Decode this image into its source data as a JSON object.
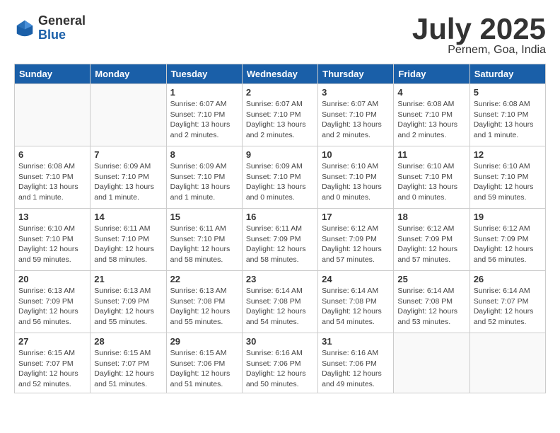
{
  "header": {
    "logo_general": "General",
    "logo_blue": "Blue",
    "month_title": "July 2025",
    "subtitle": "Pernem, Goa, India"
  },
  "days_of_week": [
    "Sunday",
    "Monday",
    "Tuesday",
    "Wednesday",
    "Thursday",
    "Friday",
    "Saturday"
  ],
  "weeks": [
    [
      {
        "day": "",
        "info": ""
      },
      {
        "day": "",
        "info": ""
      },
      {
        "day": "1",
        "info": "Sunrise: 6:07 AM\nSunset: 7:10 PM\nDaylight: 13 hours\nand 2 minutes."
      },
      {
        "day": "2",
        "info": "Sunrise: 6:07 AM\nSunset: 7:10 PM\nDaylight: 13 hours\nand 2 minutes."
      },
      {
        "day": "3",
        "info": "Sunrise: 6:07 AM\nSunset: 7:10 PM\nDaylight: 13 hours\nand 2 minutes."
      },
      {
        "day": "4",
        "info": "Sunrise: 6:08 AM\nSunset: 7:10 PM\nDaylight: 13 hours\nand 2 minutes."
      },
      {
        "day": "5",
        "info": "Sunrise: 6:08 AM\nSunset: 7:10 PM\nDaylight: 13 hours\nand 1 minute."
      }
    ],
    [
      {
        "day": "6",
        "info": "Sunrise: 6:08 AM\nSunset: 7:10 PM\nDaylight: 13 hours\nand 1 minute."
      },
      {
        "day": "7",
        "info": "Sunrise: 6:09 AM\nSunset: 7:10 PM\nDaylight: 13 hours\nand 1 minute."
      },
      {
        "day": "8",
        "info": "Sunrise: 6:09 AM\nSunset: 7:10 PM\nDaylight: 13 hours\nand 1 minute."
      },
      {
        "day": "9",
        "info": "Sunrise: 6:09 AM\nSunset: 7:10 PM\nDaylight: 13 hours\nand 0 minutes."
      },
      {
        "day": "10",
        "info": "Sunrise: 6:10 AM\nSunset: 7:10 PM\nDaylight: 13 hours\nand 0 minutes."
      },
      {
        "day": "11",
        "info": "Sunrise: 6:10 AM\nSunset: 7:10 PM\nDaylight: 13 hours\nand 0 minutes."
      },
      {
        "day": "12",
        "info": "Sunrise: 6:10 AM\nSunset: 7:10 PM\nDaylight: 12 hours\nand 59 minutes."
      }
    ],
    [
      {
        "day": "13",
        "info": "Sunrise: 6:10 AM\nSunset: 7:10 PM\nDaylight: 12 hours\nand 59 minutes."
      },
      {
        "day": "14",
        "info": "Sunrise: 6:11 AM\nSunset: 7:10 PM\nDaylight: 12 hours\nand 58 minutes."
      },
      {
        "day": "15",
        "info": "Sunrise: 6:11 AM\nSunset: 7:10 PM\nDaylight: 12 hours\nand 58 minutes."
      },
      {
        "day": "16",
        "info": "Sunrise: 6:11 AM\nSunset: 7:09 PM\nDaylight: 12 hours\nand 58 minutes."
      },
      {
        "day": "17",
        "info": "Sunrise: 6:12 AM\nSunset: 7:09 PM\nDaylight: 12 hours\nand 57 minutes."
      },
      {
        "day": "18",
        "info": "Sunrise: 6:12 AM\nSunset: 7:09 PM\nDaylight: 12 hours\nand 57 minutes."
      },
      {
        "day": "19",
        "info": "Sunrise: 6:12 AM\nSunset: 7:09 PM\nDaylight: 12 hours\nand 56 minutes."
      }
    ],
    [
      {
        "day": "20",
        "info": "Sunrise: 6:13 AM\nSunset: 7:09 PM\nDaylight: 12 hours\nand 56 minutes."
      },
      {
        "day": "21",
        "info": "Sunrise: 6:13 AM\nSunset: 7:09 PM\nDaylight: 12 hours\nand 55 minutes."
      },
      {
        "day": "22",
        "info": "Sunrise: 6:13 AM\nSunset: 7:08 PM\nDaylight: 12 hours\nand 55 minutes."
      },
      {
        "day": "23",
        "info": "Sunrise: 6:14 AM\nSunset: 7:08 PM\nDaylight: 12 hours\nand 54 minutes."
      },
      {
        "day": "24",
        "info": "Sunrise: 6:14 AM\nSunset: 7:08 PM\nDaylight: 12 hours\nand 54 minutes."
      },
      {
        "day": "25",
        "info": "Sunrise: 6:14 AM\nSunset: 7:08 PM\nDaylight: 12 hours\nand 53 minutes."
      },
      {
        "day": "26",
        "info": "Sunrise: 6:14 AM\nSunset: 7:07 PM\nDaylight: 12 hours\nand 52 minutes."
      }
    ],
    [
      {
        "day": "27",
        "info": "Sunrise: 6:15 AM\nSunset: 7:07 PM\nDaylight: 12 hours\nand 52 minutes."
      },
      {
        "day": "28",
        "info": "Sunrise: 6:15 AM\nSunset: 7:07 PM\nDaylight: 12 hours\nand 51 minutes."
      },
      {
        "day": "29",
        "info": "Sunrise: 6:15 AM\nSunset: 7:06 PM\nDaylight: 12 hours\nand 51 minutes."
      },
      {
        "day": "30",
        "info": "Sunrise: 6:16 AM\nSunset: 7:06 PM\nDaylight: 12 hours\nand 50 minutes."
      },
      {
        "day": "31",
        "info": "Sunrise: 6:16 AM\nSunset: 7:06 PM\nDaylight: 12 hours\nand 49 minutes."
      },
      {
        "day": "",
        "info": ""
      },
      {
        "day": "",
        "info": ""
      }
    ]
  ]
}
